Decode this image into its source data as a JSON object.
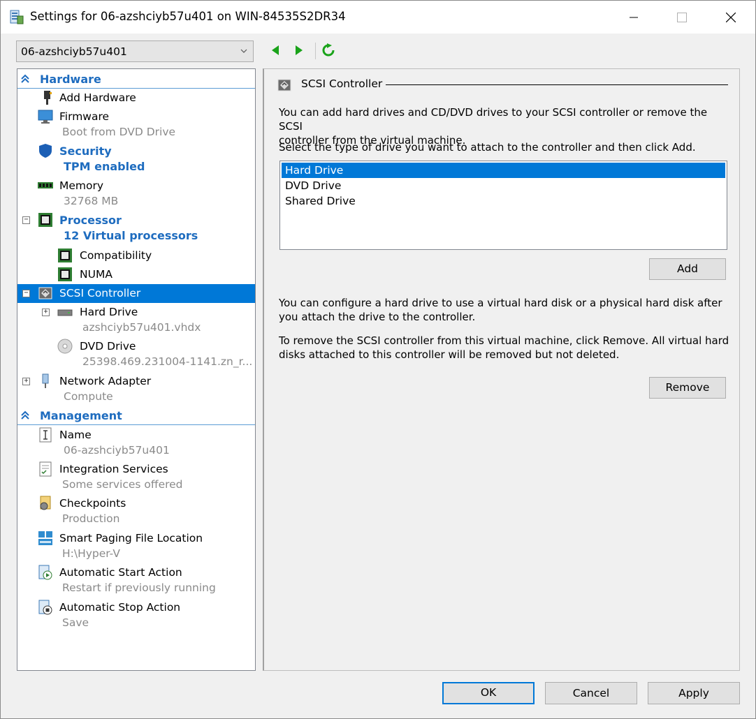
{
  "window": {
    "title": "Settings for 06-azshciyb57u401 on WIN-84535S2DR34"
  },
  "toolbar": {
    "vm_selected": "06-azshciyb57u401"
  },
  "tree": {
    "hardware_header": "Hardware",
    "add_hardware": "Add Hardware",
    "firmware": {
      "label": "Firmware",
      "sub": "Boot from DVD Drive"
    },
    "security": {
      "label": "Security",
      "sub": "TPM enabled"
    },
    "memory": {
      "label": "Memory",
      "sub": "32768 MB"
    },
    "processor": {
      "label": "Processor",
      "sub": "12 Virtual processors"
    },
    "compatibility": "Compatibility",
    "numa": "NUMA",
    "scsi": "SCSI Controller",
    "hard_drive": {
      "label": "Hard Drive",
      "sub": "azshciyb57u401.vhdx"
    },
    "dvd_drive": {
      "label": "DVD Drive",
      "sub": "25398.469.231004-1141.zn_r..."
    },
    "network": {
      "label": "Network Adapter",
      "sub": "Compute"
    },
    "management_header": "Management",
    "name": {
      "label": "Name",
      "sub": "06-azshciyb57u401"
    },
    "integration": {
      "label": "Integration Services",
      "sub": "Some services offered"
    },
    "checkpoints": {
      "label": "Checkpoints",
      "sub": "Production"
    },
    "paging": {
      "label": "Smart Paging File Location",
      "sub": "H:\\Hyper-V"
    },
    "auto_start": {
      "label": "Automatic Start Action",
      "sub": "Restart if previously running"
    },
    "auto_stop": {
      "label": "Automatic Stop Action",
      "sub": "Save"
    }
  },
  "panel": {
    "title": "SCSI Controller",
    "intro_1": "You can add hard drives and CD/DVD drives to your SCSI controller or remove the SCSI",
    "intro_2": "controller from the virtual machine.",
    "select_prompt": "Select the type of drive you want to attach to the controller and then click Add.",
    "drive_types": [
      "Hard Drive",
      "DVD Drive",
      "Shared Drive"
    ],
    "selected_drive": "Hard Drive",
    "add_label": "Add",
    "config_1": "You can configure a hard drive to use a virtual hard disk or a physical hard disk after",
    "config_2": "you attach the drive to the controller.",
    "remove_1": "To remove the SCSI controller from this virtual machine, click Remove. All virtual hard",
    "remove_2": "disks attached to this controller will be removed but not deleted.",
    "remove_label": "Remove"
  },
  "footer": {
    "ok": "OK",
    "cancel": "Cancel",
    "apply": "Apply"
  },
  "colors": {
    "accent": "#0078d7",
    "header_text": "#1e6cbf",
    "nav_green": "#1aa31a"
  }
}
